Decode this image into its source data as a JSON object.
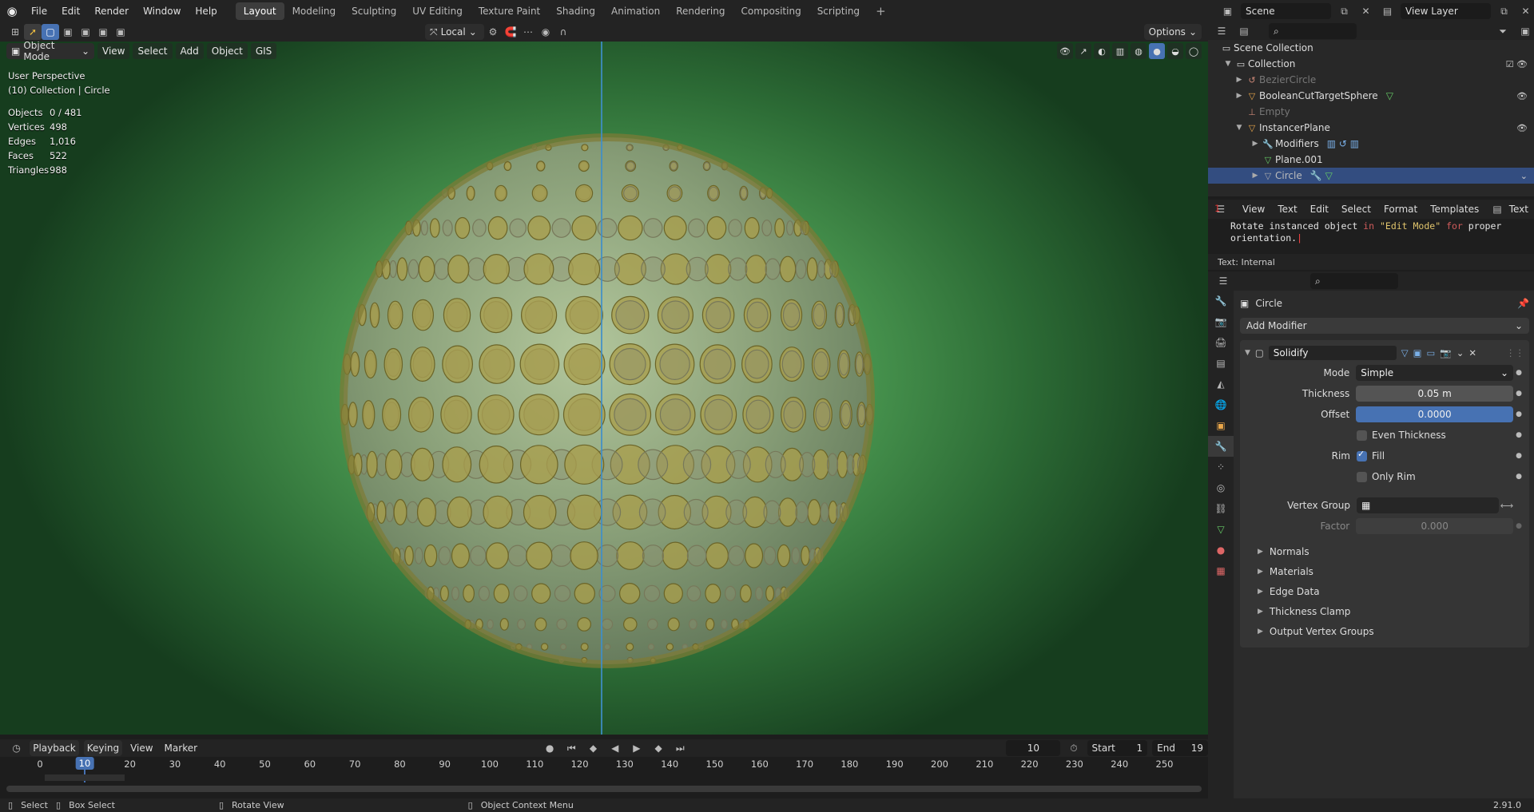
{
  "topbar": {
    "menus": [
      "File",
      "Edit",
      "Render",
      "Window",
      "Help"
    ],
    "workspaces": [
      "Layout",
      "Modeling",
      "Sculpting",
      "UV Editing",
      "Texture Paint",
      "Shading",
      "Animation",
      "Rendering",
      "Compositing",
      "Scripting"
    ],
    "active_workspace": "Layout",
    "scene": "Scene",
    "view_layer": "View Layer"
  },
  "toolbar": {
    "transform_orientation": "Local",
    "options": "Options"
  },
  "viewport": {
    "mode": "Object Mode",
    "menus": [
      "View",
      "Select",
      "Add",
      "Object",
      "GIS"
    ],
    "perspective": "User Perspective",
    "collection_info": "(10) Collection | Circle",
    "stats": [
      {
        "label": "Objects",
        "value": "0 / 481"
      },
      {
        "label": "Vertices",
        "value": "498"
      },
      {
        "label": "Edges",
        "value": "1,016"
      },
      {
        "label": "Faces",
        "value": "522"
      },
      {
        "label": "Triangles",
        "value": "988"
      }
    ]
  },
  "outliner": {
    "root": "Scene Collection",
    "collection": "Collection",
    "items": [
      "BezierCircle",
      "BooleanCutTargetSphere",
      "Empty",
      "InstancerPlane",
      "Modifiers",
      "Plane.001",
      "Circle"
    ]
  },
  "text_editor": {
    "menus": [
      "View",
      "Text",
      "Edit",
      "Select",
      "Format",
      "Templates"
    ],
    "tab": "Text",
    "line_number": "1",
    "code_a": "Rotate instanced object ",
    "code_in": "in",
    "code_str": "\"Edit Mode\"",
    "code_for": "for",
    "code_b": " proper",
    "code_c": "orientation.",
    "footer": "Text: Internal"
  },
  "properties": {
    "object_name": "Circle",
    "add_modifier": "Add Modifier",
    "modifier_name": "Solidify",
    "mode_label": "Mode",
    "mode_value": "Simple",
    "thickness_label": "Thickness",
    "thickness_value": "0.05 m",
    "offset_label": "Offset",
    "offset_value": "0.0000",
    "even_thickness": "Even Thickness",
    "rim_label": "Rim",
    "fill": "Fill",
    "only_rim": "Only Rim",
    "vertex_group_label": "Vertex Group",
    "factor_label": "Factor",
    "factor_value": "0.000",
    "subpanels": [
      "Normals",
      "Materials",
      "Edge Data",
      "Thickness Clamp",
      "Output Vertex Groups"
    ]
  },
  "timeline": {
    "menus": [
      "Playback",
      "Keying",
      "View",
      "Marker"
    ],
    "current_frame": "10",
    "start_label": "Start",
    "start": "1",
    "end_label": "End",
    "end": "19",
    "ruler": [
      "0",
      "10",
      "20",
      "30",
      "40",
      "50",
      "60",
      "70",
      "80",
      "90",
      "100",
      "110",
      "120",
      "130",
      "140",
      "150",
      "160",
      "170",
      "180",
      "190",
      "200",
      "210",
      "220",
      "230",
      "240",
      "250"
    ]
  },
  "statusbar": {
    "select": "Select",
    "box_select": "Box Select",
    "rotate_view": "Rotate View",
    "context_menu": "Object Context Menu",
    "version": "2.91.0"
  }
}
